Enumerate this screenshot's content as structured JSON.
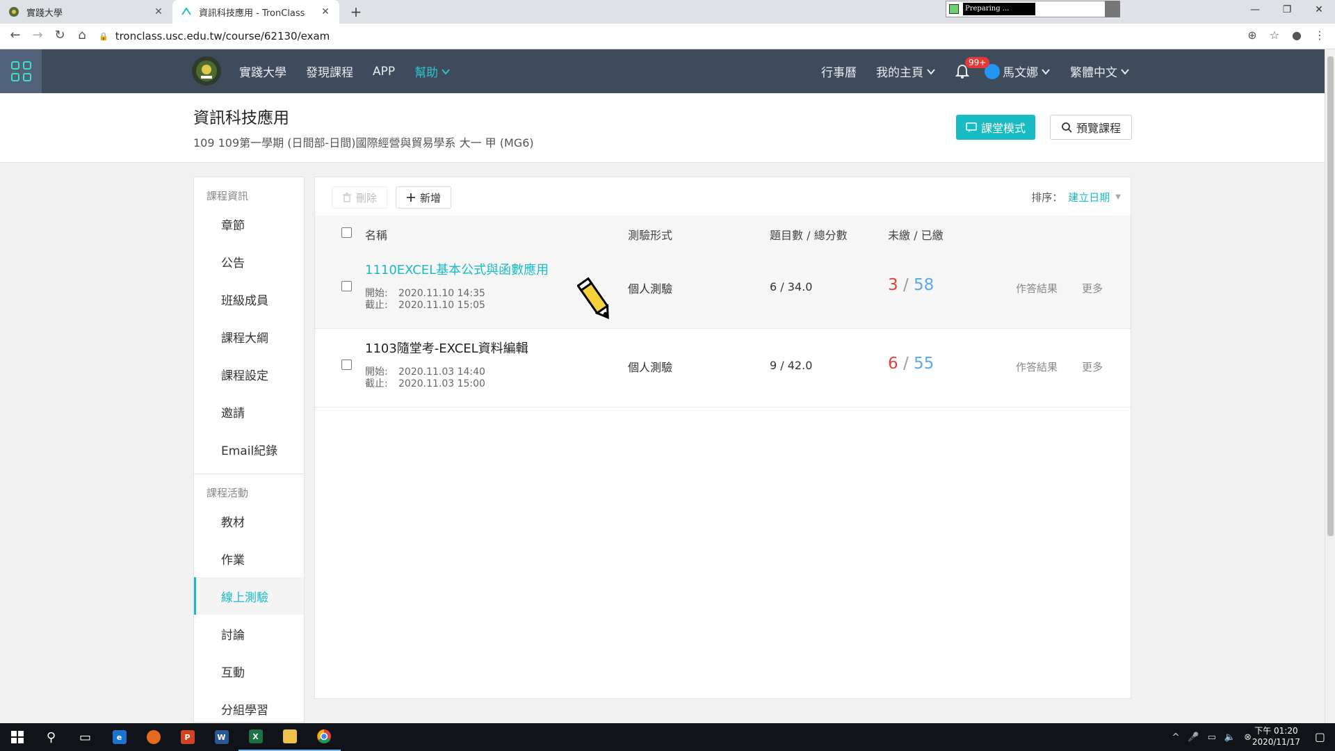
{
  "browser": {
    "tabs": [
      {
        "title": "實踐大學"
      },
      {
        "title": "資訊科技應用 - TronClass"
      }
    ],
    "url": "tronclass.usc.edu.tw/course/62130/exam",
    "preparing_text": "Preparing ..."
  },
  "header": {
    "nav": [
      "實踐大學",
      "發現課程",
      "APP"
    ],
    "help": "幫助",
    "calendar": "行事曆",
    "my_home": "我的主頁",
    "notif_badge": "99+",
    "user": "馬文娜",
    "language": "繁體中文"
  },
  "course": {
    "title": "資訊科技應用",
    "subtitle": "109 109第一學期 (日間部-日間)國際經營與貿易學系 大一 甲 (MG6)",
    "class_mode_btn": "課堂模式",
    "preview_btn": "預覽課程"
  },
  "sidebar": {
    "section1": "課程資訊",
    "items1": [
      "章節",
      "公告",
      "班級成員",
      "課程大綱",
      "課程設定",
      "邀請",
      "Email紀錄"
    ],
    "section2": "課程活動",
    "items2": [
      "教材",
      "作業",
      "線上測驗",
      "討論",
      "互動",
      "分組學習"
    ],
    "active": "線上測驗"
  },
  "toolbar": {
    "delete": "刪除",
    "add": "新增",
    "sort_label": "排序：",
    "sort_value": "建立日期"
  },
  "table": {
    "headers": [
      "名稱",
      "測驗形式",
      "題目數 / 總分數",
      "未繳 / 已繳"
    ],
    "rows": [
      {
        "name": "1110EXCEL基本公式與函數應用",
        "start_label": "開始:",
        "start": "2020.11.10 14:35",
        "end_label": "截止:",
        "end": "2020.11.10 15:05",
        "type": "個人測驗",
        "score": "6 / 34.0",
        "unsubmitted": "3",
        "sep": " / ",
        "submitted": "58",
        "results": "作答結果",
        "more": "更多"
      },
      {
        "name": "1103隨堂考-EXCEL資料編輯",
        "start_label": "開始:",
        "start": "2020.11.03 14:40",
        "end_label": "截止:",
        "end": "2020.11.03 15:00",
        "type": "個人測驗",
        "score": "9 / 42.0",
        "unsubmitted": "6",
        "sep": " / ",
        "submitted": "55",
        "results": "作答結果",
        "more": "更多"
      }
    ]
  },
  "taskbar": {
    "time_top": "下午 01:20",
    "time_bottom": "2020/11/17"
  },
  "colors": {
    "accent": "#19bcc3",
    "header_bg": "#3d4b5c",
    "unsubmitted": "#e03e3e",
    "submitted": "#5aa9e6"
  }
}
